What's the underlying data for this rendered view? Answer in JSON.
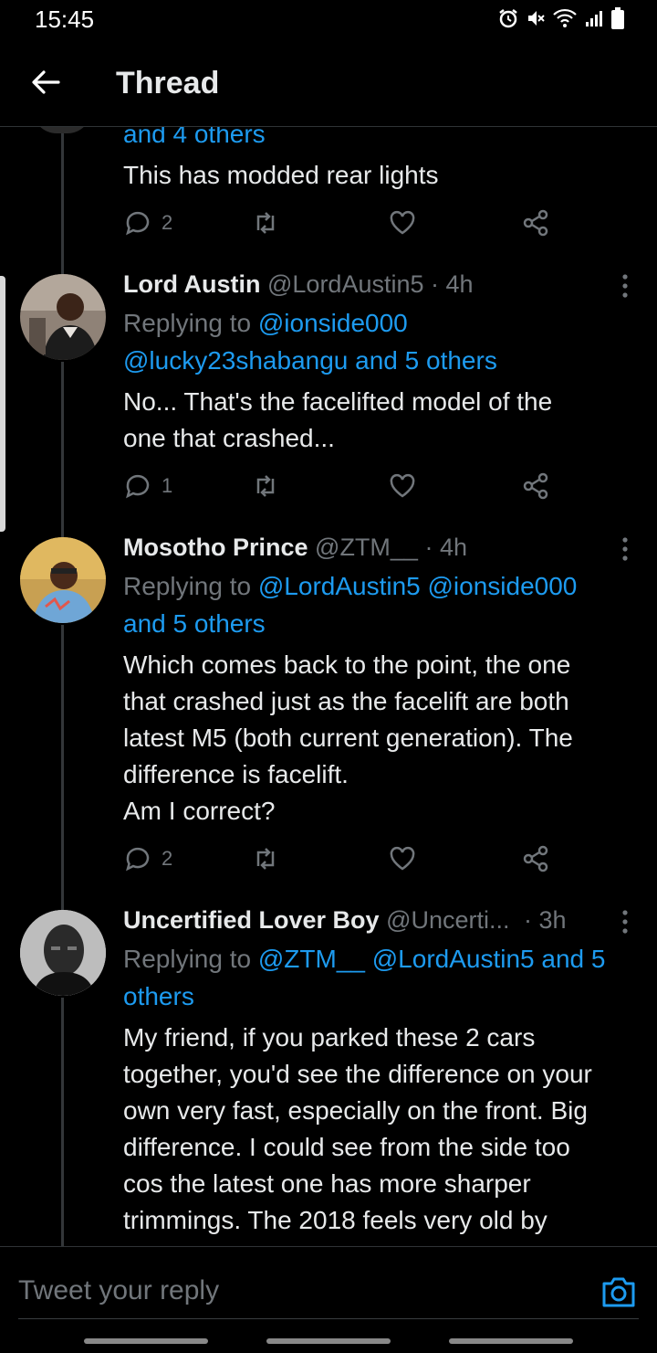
{
  "status_bar": {
    "time": "15:45"
  },
  "header": {
    "title": "Thread"
  },
  "colors": {
    "accent": "#1d9bf0",
    "muted": "#71767b",
    "text": "#e7e9ea",
    "background": "#000000"
  },
  "top_partial": {
    "reply_tail": "and 4 others",
    "text": "This has modded rear lights",
    "reply_count": "2"
  },
  "tweets": [
    {
      "name": "Lord Austin",
      "handle": "@LordAustin5",
      "time": "· 4h",
      "replying_prefix": "Replying to",
      "mention_1": "@ionside000",
      "mention_2": "@lucky23shabangu and 5 others",
      "text_1": "No... That's the facelifted model of the",
      "text_2": "one that crashed...",
      "reply_count": "1"
    },
    {
      "name": "Mosotho Prince",
      "handle": "@ZTM__",
      "time": "· 4h",
      "replying_prefix": "Replying to",
      "mention_1": "@LordAustin5 @ionside000",
      "mention_2": "and 5 others",
      "text_1": "Which comes back to the point, the one",
      "text_2": "that crashed just as the facelift are both",
      "text_3": "latest M5 (both current generation). The",
      "text_4": "difference is facelift.",
      "text_5": "Am I correct?",
      "reply_count": "2"
    },
    {
      "name": "Uncertified Lover Boy",
      "handle": "@Uncerti...",
      "time": "· 3h",
      "replying_prefix": "Replying to",
      "mention_1": "@ZTM__ @LordAustin5 and 5",
      "mention_2": "others",
      "text_1": "My friend, if you parked these 2 cars",
      "text_2": "together, you'd see the difference on your",
      "text_3": "own very fast, especially on the front. Big",
      "text_4": "difference. I could see from the side too",
      "text_5": "cos the latest one has more sharper",
      "text_6": "trimmings. The 2018 feels very old by"
    }
  ],
  "composer": {
    "placeholder": "Tweet your reply"
  }
}
